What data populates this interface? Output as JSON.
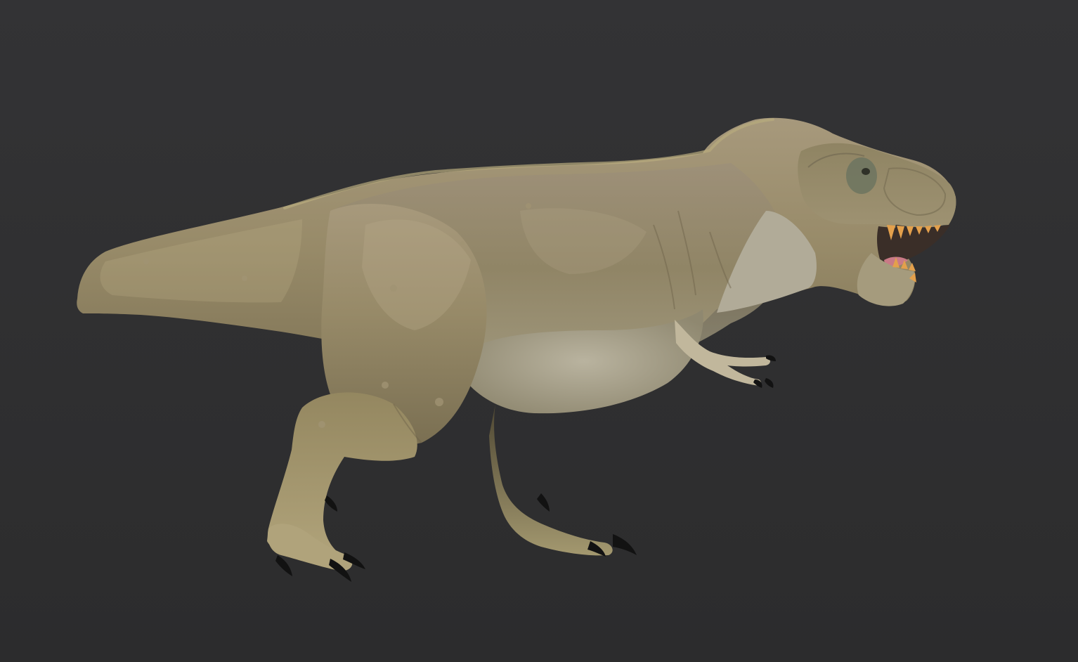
{
  "scene": {
    "subject": "tyrannosaurus-rex-sculpt",
    "colors": {
      "background_top": "#333335",
      "background_bottom": "#2c2c2d",
      "skin_light": "#a99a72",
      "skin_mid": "#8c7f5e",
      "skin_dark": "#5e5540",
      "belly": "#b9b39f",
      "claw": "#111111",
      "teeth": "#e3a04c",
      "tongue": "#c97a86",
      "eye": "#6f7561"
    }
  }
}
